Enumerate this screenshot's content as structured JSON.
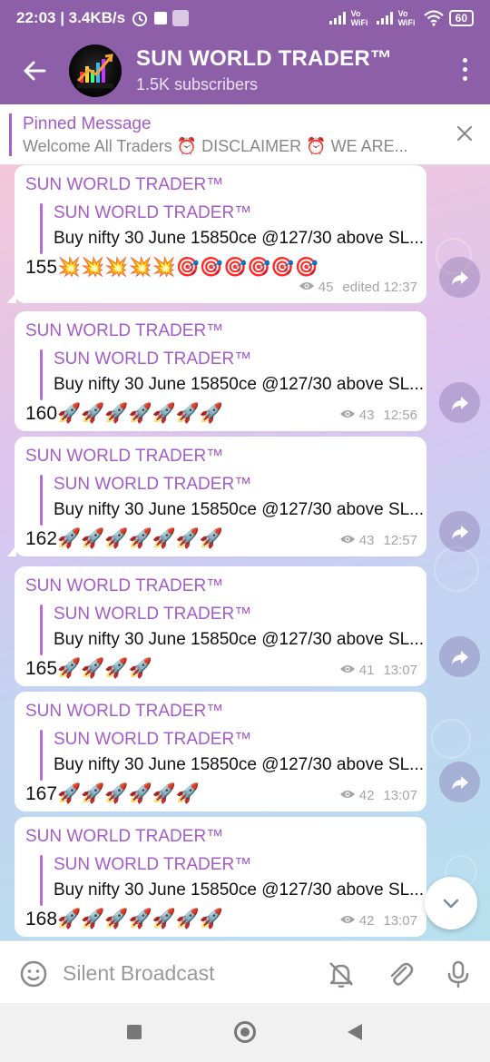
{
  "status_bar": {
    "time_speed": "22:03 | 3.4KB/s",
    "network_1": "Vo WiFi",
    "network_2": "Vo WiFi",
    "battery": "60"
  },
  "header": {
    "title": "SUN WORLD TRADER™",
    "subtitle": "1.5K subscribers",
    "avatar_logo_text": "SUN WORLD TRADER"
  },
  "pinned": {
    "label": "Pinned Message",
    "text": "Welcome All Traders ⏰ DISCLAIMER ⏰ WE ARE..."
  },
  "messages": [
    {
      "sender": "SUN WORLD TRADER™",
      "fwd_name": "SUN WORLD TRADER™",
      "fwd_text": "Buy nifty 30 June 15850ce @127/30 above SL...",
      "body": "155💥💥💥💥💥🎯🎯🎯🎯🎯🎯",
      "views": "45",
      "time": "edited 12:37"
    },
    {
      "sender": "SUN WORLD TRADER™",
      "fwd_name": "SUN WORLD TRADER™",
      "fwd_text": "Buy nifty 30 June 15850ce @127/30 above SL...",
      "body": "160🚀🚀🚀🚀🚀🚀🚀",
      "views": "43",
      "time": "12:56"
    },
    {
      "sender": "SUN WORLD TRADER™",
      "fwd_name": "SUN WORLD TRADER™",
      "fwd_text": "Buy nifty 30 June 15850ce @127/30 above SL...",
      "body": "162🚀🚀🚀🚀🚀🚀🚀",
      "views": "43",
      "time": "12:57"
    },
    {
      "sender": "SUN WORLD TRADER™",
      "fwd_name": "SUN WORLD TRADER™",
      "fwd_text": "Buy nifty 30 June 15850ce @127/30 above SL...",
      "body": "165🚀🚀🚀🚀",
      "views": "41",
      "time": "13:07"
    },
    {
      "sender": "SUN WORLD TRADER™",
      "fwd_name": "SUN WORLD TRADER™",
      "fwd_text": "Buy nifty 30 June 15850ce @127/30 above SL...",
      "body": "167🚀🚀🚀🚀🚀🚀",
      "views": "42",
      "time": "13:07"
    },
    {
      "sender": "SUN WORLD TRADER™",
      "fwd_name": "SUN WORLD TRADER™",
      "fwd_text": "Buy nifty 30 June 15850ce @127/30 above SL...",
      "body": "168🚀🚀🚀🚀🚀🚀🚀",
      "views": "42",
      "time": "13:07"
    }
  ],
  "composer": {
    "placeholder": "Silent Broadcast"
  },
  "icons": {
    "back": "back-arrow-icon",
    "menu": "more-vert-icon",
    "close": "close-icon",
    "views": "eye-icon",
    "share": "share-icon",
    "scroll": "chevron-down-icon",
    "emoji": "emoji-icon",
    "bell": "bell-off-icon",
    "attach": "paperclip-icon",
    "mic": "mic-icon"
  },
  "colors": {
    "header": "#8d5fa9",
    "accent": "#a45cc8",
    "bubble": "#ffffff"
  }
}
